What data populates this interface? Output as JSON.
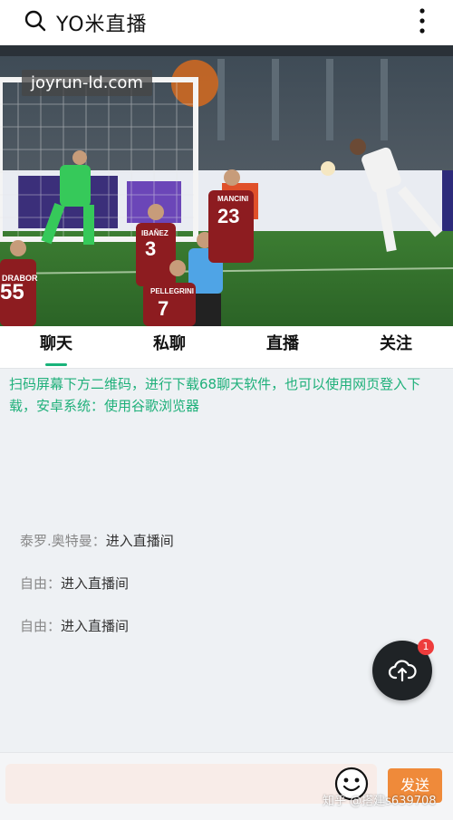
{
  "header": {
    "title": "YO米直播"
  },
  "video": {
    "watermark": "joyrun-ld.com",
    "players": [
      {
        "number": "55",
        "name": "DRABOR"
      },
      {
        "number": "3",
        "name": "IBAÑEZ"
      },
      {
        "number": "23",
        "name": "MANCINI"
      },
      {
        "number": "7",
        "name": "PELLEGRINI"
      }
    ]
  },
  "tabs": [
    {
      "label": "聊天"
    },
    {
      "label": "私聊"
    },
    {
      "label": "直播"
    },
    {
      "label": "关注"
    }
  ],
  "notice": "扫码屏幕下方二维码，进行下载68聊天软件，也可以使用网页登入下载，安卓系统：使用谷歌浏览器",
  "chat": [
    {
      "user": "泰罗.奥特曼：",
      "text": "进入直播间"
    },
    {
      "user": "自由：",
      "text": "进入直播间"
    },
    {
      "user": "自由：",
      "text": "进入直播间"
    }
  ],
  "fab": {
    "badge": "1"
  },
  "bottom": {
    "input_placeholder": "",
    "send_label": "发送",
    "watermark": "知乎 @搭建s639708"
  },
  "colors": {
    "accent": "#19b37a",
    "send": "#ef8a3a",
    "badge": "#ee3c3c"
  }
}
